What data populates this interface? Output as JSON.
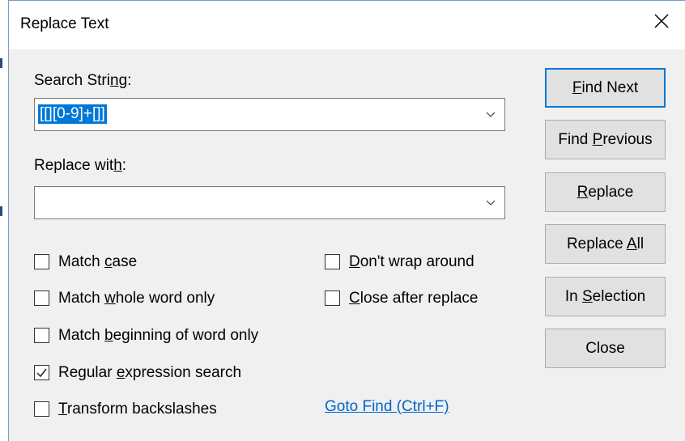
{
  "window": {
    "title": "Replace Text",
    "close_icon": "close-icon"
  },
  "search": {
    "label_pre": "Search Stri",
    "label_u": "n",
    "label_post": "g:",
    "value": "[[][0-9]+[]]"
  },
  "replace": {
    "label_pre": "Replace wit",
    "label_u": "h",
    "label_post": ":",
    "value": ""
  },
  "options": {
    "match_case": {
      "pre": "Match ",
      "u": "c",
      "post": "ase",
      "checked": false
    },
    "match_whole_word": {
      "pre": "Match ",
      "u": "w",
      "post": "hole word only",
      "checked": false
    },
    "match_beginning": {
      "pre": "Match ",
      "u": "b",
      "post": "eginning of word only",
      "checked": false
    },
    "regex": {
      "pre": "Regular ",
      "u": "e",
      "post": "xpression search",
      "checked": true
    },
    "transform_backslashes": {
      "pre": "",
      "u": "T",
      "post": "ransform backslashes",
      "checked": false
    },
    "dont_wrap": {
      "pre": "",
      "u": "D",
      "post": "on't wrap around",
      "checked": false
    },
    "close_after_replace": {
      "pre": "",
      "u": "C",
      "post": "lose after replace",
      "checked": false
    }
  },
  "goto_find_link": "Goto Find (Ctrl+F)",
  "buttons": {
    "find_next": {
      "pre": "",
      "u": "F",
      "post": "ind Next"
    },
    "find_previous": {
      "pre": "Find ",
      "u": "P",
      "post": "revious"
    },
    "replace": {
      "pre": "",
      "u": "R",
      "post": "eplace"
    },
    "replace_all": {
      "pre": "Replace ",
      "u": "A",
      "post": "ll"
    },
    "in_selection": {
      "pre": "In ",
      "u": "S",
      "post": "election"
    },
    "close": {
      "pre": "Close",
      "u": "",
      "post": ""
    }
  },
  "colors": {
    "accent": "#0078d7",
    "link": "#0066cc",
    "dialog_bg": "#f0f0f0",
    "button_bg": "#e1e1e1"
  }
}
